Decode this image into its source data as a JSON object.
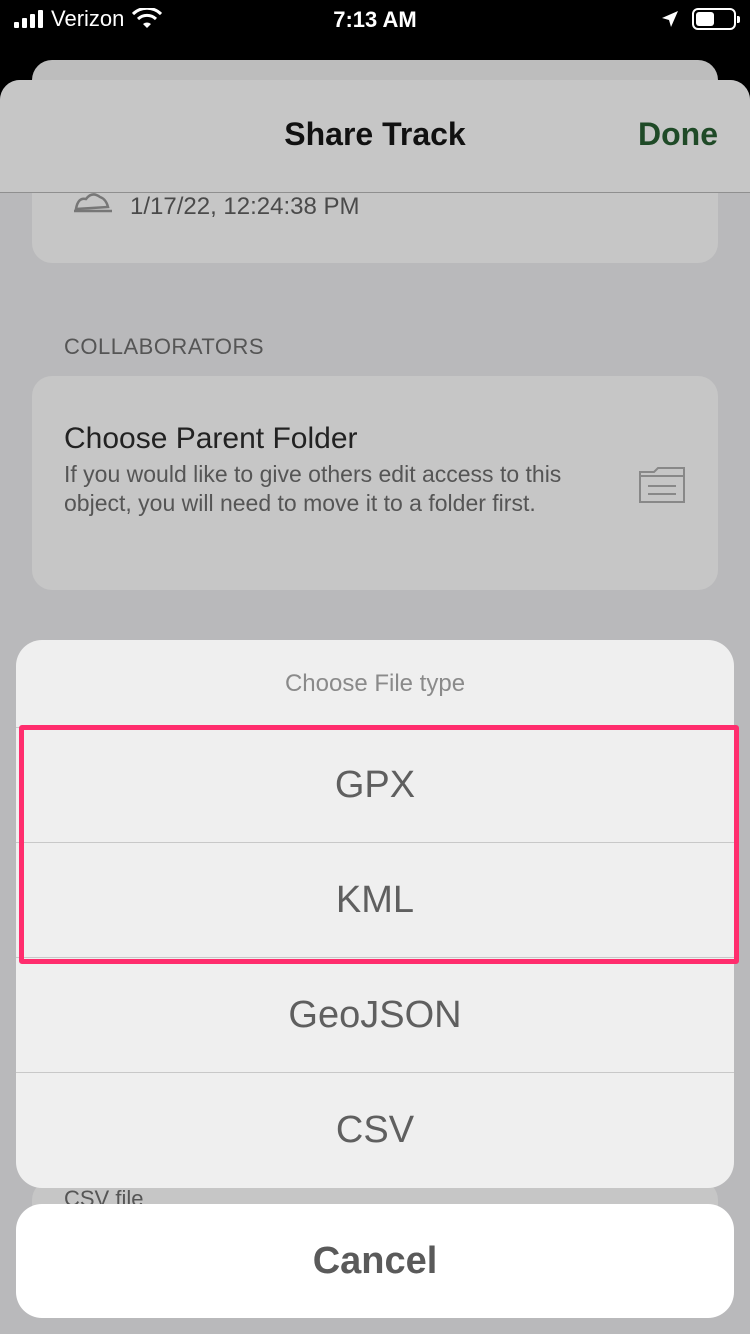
{
  "status_bar": {
    "carrier": "Verizon",
    "time": "7:13 AM",
    "battery_level": 0.5
  },
  "sheet": {
    "title": "Share Track",
    "done_label": "Done",
    "track_date": "1/17/22, 12:24:38 PM",
    "collaborators_label": "COLLABORATORS",
    "folder_title": "Choose Parent Folder",
    "folder_description": "If you would like to give others edit access to this object, you will need to move it to a folder first.",
    "peek_text": "CSV file"
  },
  "action_sheet": {
    "title": "Choose File type",
    "options": [
      {
        "label": "GPX"
      },
      {
        "label": "KML"
      },
      {
        "label": "GeoJSON"
      },
      {
        "label": "CSV"
      }
    ],
    "cancel_label": "Cancel"
  },
  "colors": {
    "accent_done": "#1f4a27",
    "highlight": "#ff2d6d"
  },
  "icons": [
    "signal-icon",
    "wifi-icon",
    "location-arrow-icon",
    "battery-icon",
    "track-icon",
    "folder-icon"
  ]
}
